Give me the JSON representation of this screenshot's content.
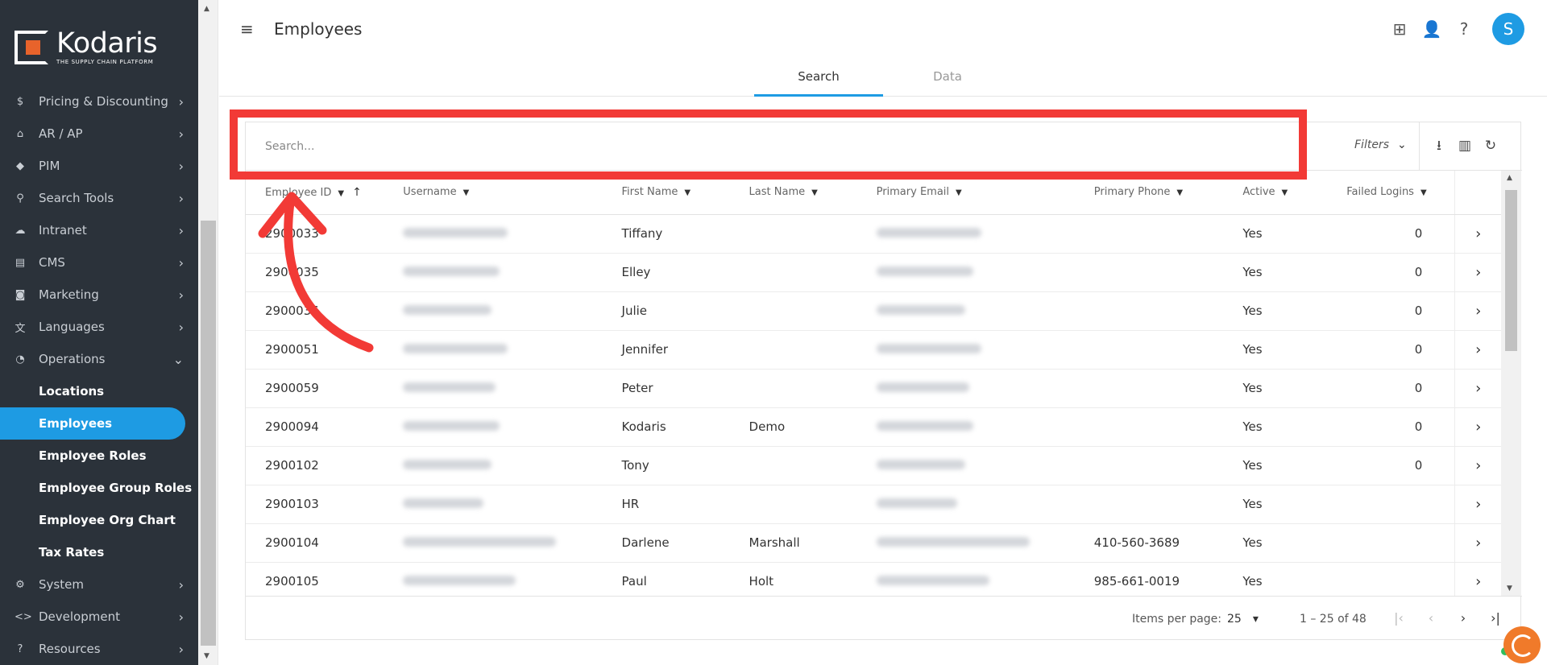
{
  "app": {
    "brand": "Kodaris",
    "tagline": "THE SUPPLY CHAIN PLATFORM"
  },
  "sidebar": {
    "items": [
      {
        "icon": "$",
        "label": "Pricing & Discounting"
      },
      {
        "icon": "⌂",
        "label": "AR / AP"
      },
      {
        "icon": "◆",
        "label": "PIM"
      },
      {
        "icon": "⚲",
        "label": "Search Tools"
      },
      {
        "icon": "☁",
        "label": "Intranet"
      },
      {
        "icon": "▤",
        "label": "CMS"
      },
      {
        "icon": "◙",
        "label": "Marketing"
      },
      {
        "icon": "文",
        "label": "Languages"
      },
      {
        "icon": "◔",
        "label": "Operations"
      }
    ],
    "sub_items": [
      "Locations",
      "Employees",
      "Employee Roles",
      "Employee Group Roles",
      "Employee Org Chart",
      "Tax Rates"
    ],
    "bottom_items": [
      {
        "icon": "⚙",
        "label": "System"
      },
      {
        "icon": "<>",
        "label": "Development"
      },
      {
        "icon": "?",
        "label": "Resources"
      }
    ]
  },
  "header": {
    "title": "Employees",
    "avatar_letter": "S"
  },
  "tabs": [
    "Search",
    "Data"
  ],
  "search": {
    "placeholder": "Search...",
    "filters_label": "Filters"
  },
  "table": {
    "columns": [
      "Employee ID",
      "Username",
      "First Name",
      "Last Name",
      "Primary Email",
      "Primary Phone",
      "Active",
      "Failed Logins"
    ],
    "rows": [
      {
        "id": "2900033",
        "first": "Tiffany",
        "last": "",
        "phone": "",
        "active": "Yes",
        "failed": "0"
      },
      {
        "id": "2900035",
        "first": "Elley",
        "last": "",
        "phone": "",
        "active": "Yes",
        "failed": "0"
      },
      {
        "id": "2900036",
        "first": "Julie",
        "last": "",
        "phone": "",
        "active": "Yes",
        "failed": "0"
      },
      {
        "id": "2900051",
        "first": "Jennifer",
        "last": "",
        "phone": "",
        "active": "Yes",
        "failed": "0"
      },
      {
        "id": "2900059",
        "first": "Peter",
        "last": "",
        "phone": "",
        "active": "Yes",
        "failed": "0"
      },
      {
        "id": "2900094",
        "first": "Kodaris",
        "last": "Demo",
        "phone": "",
        "active": "Yes",
        "failed": "0"
      },
      {
        "id": "2900102",
        "first": "Tony",
        "last": "",
        "phone": "",
        "active": "Yes",
        "failed": "0"
      },
      {
        "id": "2900103",
        "first": "HR",
        "last": "",
        "phone": "",
        "active": "Yes",
        "failed": ""
      },
      {
        "id": "2900104",
        "first": "Darlene",
        "last": "Marshall",
        "phone": "410-560-3689",
        "active": "Yes",
        "failed": ""
      },
      {
        "id": "2900105",
        "first": "Paul",
        "last": "Holt",
        "phone": "985-661-0019",
        "active": "Yes",
        "failed": ""
      }
    ]
  },
  "paginator": {
    "items_per_page_label": "Items per page:",
    "page_size": "25",
    "range": "1 – 25 of 48"
  },
  "colors": {
    "sidebar_bg": "#2b323a",
    "accent": "#1e9be3",
    "annotation": "#f23a36"
  }
}
